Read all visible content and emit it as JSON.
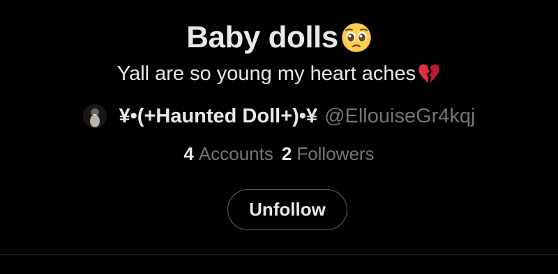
{
  "list": {
    "title": "Baby dolls",
    "title_emoji": "pleading-face-icon",
    "description": "Yall are so young my heart aches",
    "description_emoji": "broken-heart-icon",
    "owner": {
      "display_name": "¥•(+Haunted Doll+)•¥",
      "handle": "@EllouiseGr4kqj"
    },
    "stats": {
      "accounts_count": "4",
      "accounts_label": "Accounts",
      "followers_count": "2",
      "followers_label": "Followers"
    },
    "unfollow_label": "Unfollow"
  },
  "colors": {
    "background": "#000000",
    "primary_text": "#e7e9ea",
    "secondary_text": "#71767b",
    "button_border": "#536471",
    "divider": "#2f3336",
    "emoji_face": "#ffcc4d",
    "emoji_heart": "#dd2e44"
  }
}
